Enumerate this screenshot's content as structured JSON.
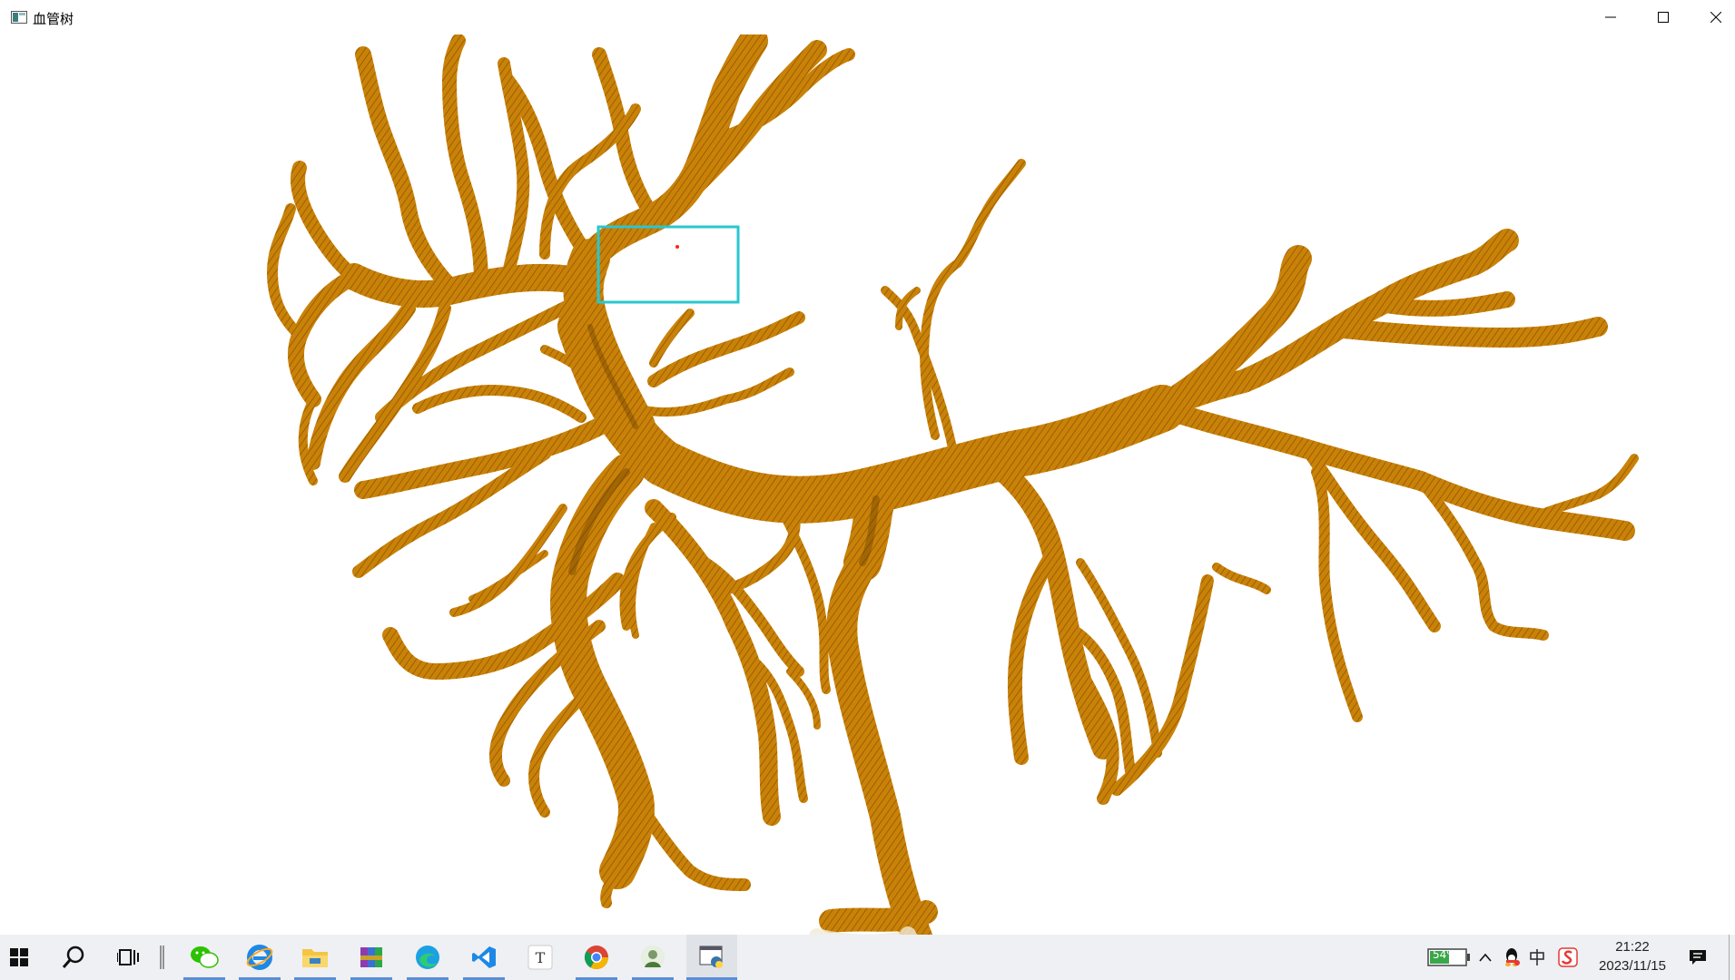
{
  "window": {
    "title": "血管树"
  },
  "taskbar": {
    "apps": [
      "start-icon",
      "search-icon",
      "task-view-icon",
      "wechat-icon",
      "ie-icon",
      "file-explorer-icon",
      "winrar-icon",
      "edge-icon",
      "vscode-icon",
      "typora-icon",
      "chrome-icon",
      "photo-app-icon",
      "python-app-icon"
    ],
    "battery_label": "54%",
    "tray_icons": [
      "chevron-up-icon",
      "qq-icon",
      "ime-icon",
      "sogou-icon"
    ],
    "ime_label": "中",
    "time": "21:22",
    "date": "2023/11/15"
  },
  "colors": {
    "vessel": "#c77f0a",
    "vessel_dark": "#6a3d00",
    "selection": "#28c7d0",
    "taskbar_bg": "#eef0f3",
    "active_underline": "#5a8ed6"
  }
}
